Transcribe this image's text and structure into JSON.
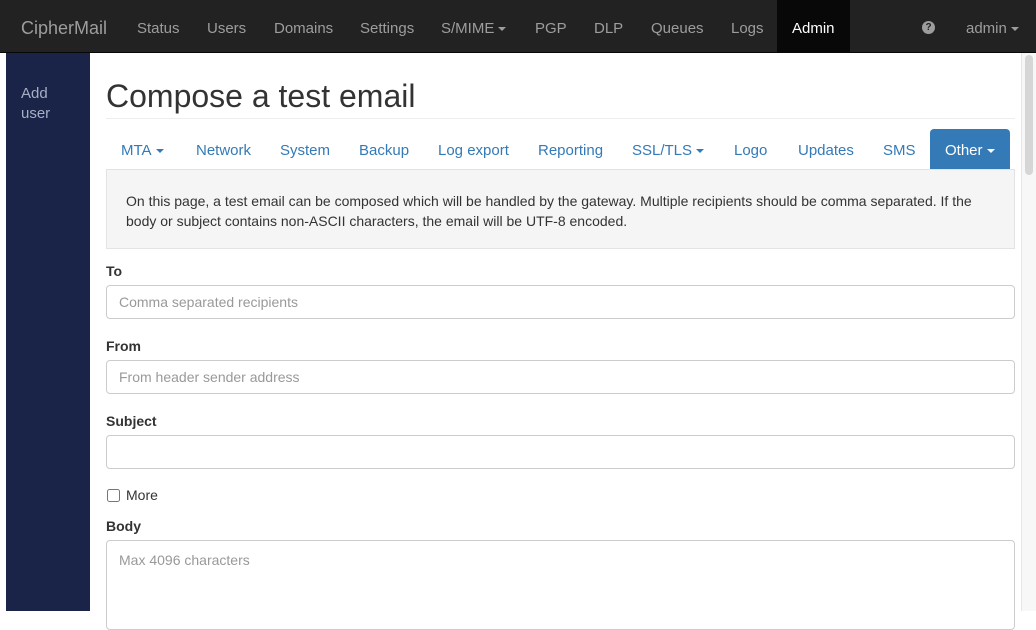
{
  "navbar": {
    "brand": "CipherMail",
    "items": [
      {
        "label": "Status"
      },
      {
        "label": "Users"
      },
      {
        "label": "Domains"
      },
      {
        "label": "Settings"
      },
      {
        "label": "S/MIME"
      },
      {
        "label": "PGP"
      },
      {
        "label": "DLP"
      },
      {
        "label": "Queues"
      },
      {
        "label": "Logs"
      },
      {
        "label": "Admin"
      }
    ],
    "help_icon": "question-circle-icon",
    "user_menu": "admin"
  },
  "sidebar": {
    "items": [
      {
        "label": "Add user"
      }
    ]
  },
  "page": {
    "title": "Compose a test email"
  },
  "tabs": [
    {
      "label": "MTA"
    },
    {
      "label": "Network"
    },
    {
      "label": "System"
    },
    {
      "label": "Backup"
    },
    {
      "label": "Log export"
    },
    {
      "label": "Reporting"
    },
    {
      "label": "SSL/TLS"
    },
    {
      "label": "Logo"
    },
    {
      "label": "Updates"
    },
    {
      "label": "SMS"
    },
    {
      "label": "Other"
    }
  ],
  "info": "On this page, a test email can be composed which will be handled by the gateway. Multiple recipients should be comma separated. If the body or subject contains non-ASCII characters, the email will be UTF-8 encoded.",
  "form": {
    "to": {
      "label": "To",
      "value": "",
      "placeholder": "Comma separated recipients"
    },
    "from": {
      "label": "From",
      "value": "",
      "placeholder": "From header sender address"
    },
    "subject": {
      "label": "Subject",
      "value": "",
      "placeholder": ""
    },
    "more": {
      "label": "More",
      "checked": false
    },
    "body": {
      "label": "Body",
      "value": "",
      "placeholder": "Max 4096 characters"
    }
  },
  "colors": {
    "navbar_bg": "#222222",
    "sidebar_bg": "#1a2348",
    "accent": "#337ab7"
  }
}
